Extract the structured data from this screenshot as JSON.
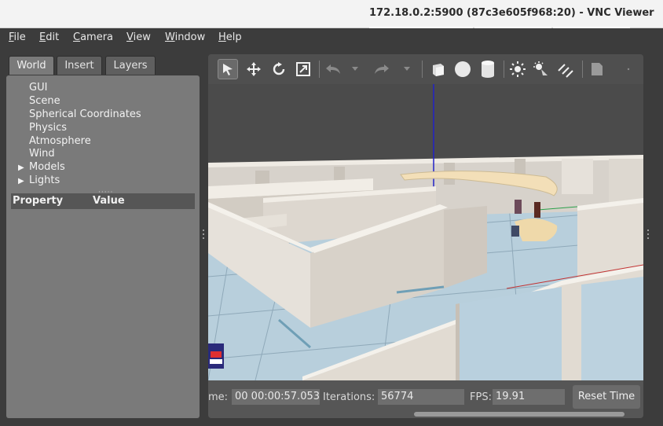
{
  "window": {
    "title": "172.18.0.2:5900 (87c3e605f968:20) - VNC Viewer"
  },
  "menu": [
    {
      "mnemonic": "F",
      "rest": "ile"
    },
    {
      "mnemonic": "E",
      "rest": "dit"
    },
    {
      "mnemonic": "C",
      "rest": "amera"
    },
    {
      "mnemonic": "V",
      "rest": "iew"
    },
    {
      "mnemonic": "W",
      "rest": "indow"
    },
    {
      "mnemonic": "H",
      "rest": "elp"
    }
  ],
  "tabs": [
    {
      "label": "World"
    },
    {
      "label": "Insert"
    },
    {
      "label": "Layers"
    }
  ],
  "tree": [
    {
      "label": "GUI"
    },
    {
      "label": "Scene"
    },
    {
      "label": "Spherical Coordinates"
    },
    {
      "label": "Physics"
    },
    {
      "label": "Atmosphere"
    },
    {
      "label": "Wind"
    },
    {
      "label": "Models"
    },
    {
      "label": "Lights"
    }
  ],
  "props": {
    "property": "Property",
    "value": "Value"
  },
  "toolbar": {
    "icons": [
      "select-arrow-icon",
      "translate-icon",
      "rotate-icon",
      "scale-icon",
      "undo-icon",
      "undo-dropdown-icon",
      "redo-icon",
      "redo-dropdown-icon",
      "box-icon",
      "sphere-icon",
      "cylinder-icon",
      "point-light-icon",
      "spot-light-icon",
      "directional-light-icon",
      "screenshot-icon"
    ]
  },
  "status": {
    "time_label": "me:",
    "time_value": "00 00:00:57.053",
    "iterations_label": "Iterations:",
    "iterations_value": "56774",
    "fps_label": "FPS:",
    "fps_value": "19.91",
    "reset_label": "Reset Time"
  }
}
